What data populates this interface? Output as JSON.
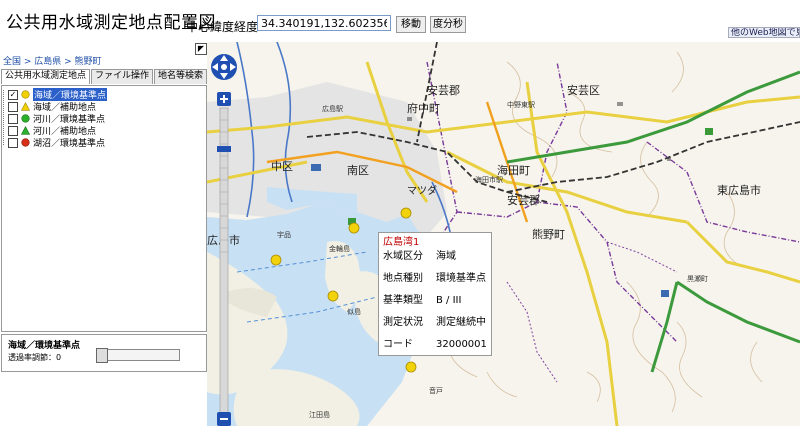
{
  "header": {
    "title": "公共用水域測定地点配置図",
    "coord_label": "中心緯度経度:",
    "coord_value": "34.340191,132.602356",
    "move_button": "移動",
    "dms_button": "度分秒",
    "other_map_link": "他のWeb地図で見"
  },
  "sidebar": {
    "breadcrumb": "全国 > 広島県 > 熊野町",
    "tabs": [
      "公共用水域測定地点",
      "ファイル操作",
      "地名等検索"
    ],
    "items": [
      {
        "label": "海域／環境基準点",
        "checked": true,
        "color": "#f0d000",
        "shape": "circle"
      },
      {
        "label": "海域／補助地点",
        "checked": false,
        "color": "#f0d000",
        "shape": "triangle"
      },
      {
        "label": "河川／環境基準点",
        "checked": false,
        "color": "#2bb02b",
        "shape": "circle"
      },
      {
        "label": "河川／補助地点",
        "checked": false,
        "color": "#2bb02b",
        "shape": "triangle"
      },
      {
        "label": "湖沼／環境基準点",
        "checked": false,
        "color": "#d83018",
        "shape": "circle"
      }
    ],
    "legend_title": "海域／環境基準点",
    "transparency_label": "透過率調節：0"
  },
  "map": {
    "labels": {
      "aki_gun_n": "安芸郡",
      "fuchu": "府中町",
      "aki_ku": "安芸区",
      "naka_ku": "中区",
      "minami_ku": "南区",
      "kaita": "海田町",
      "aki_gun_s": "安芸郡",
      "kumano": "熊野町",
      "higashihiroshima": "東広島市",
      "hiroshima": "広島市",
      "mazda": "マツダ",
      "hiroshima_sta": "広島駅",
      "ujina": "宇品",
      "kanawa": "金輪島",
      "ninoshima": "似島",
      "etajima": "江田島",
      "ondo": "音戸",
      "nakano": "中野東駅",
      "kaitaichi": "海田市駅",
      "kurose": "黒瀬町"
    },
    "popup": {
      "name": "広島湾1",
      "rows": [
        {
          "key": "水域区分",
          "value": "海域"
        },
        {
          "key": "地点種別",
          "value": "環境基準点"
        },
        {
          "key": "基準類型",
          "value": "B / III"
        },
        {
          "key": "測定状況",
          "value": "測定継続中"
        },
        {
          "key": "コード",
          "value": "32000001"
        }
      ]
    },
    "colors": {
      "sea": "#c8e0f4",
      "urban": "#e6e6e6",
      "land": "#f6f4ec",
      "marker": "#f2d20a",
      "highway": "#3c9a3c"
    }
  }
}
